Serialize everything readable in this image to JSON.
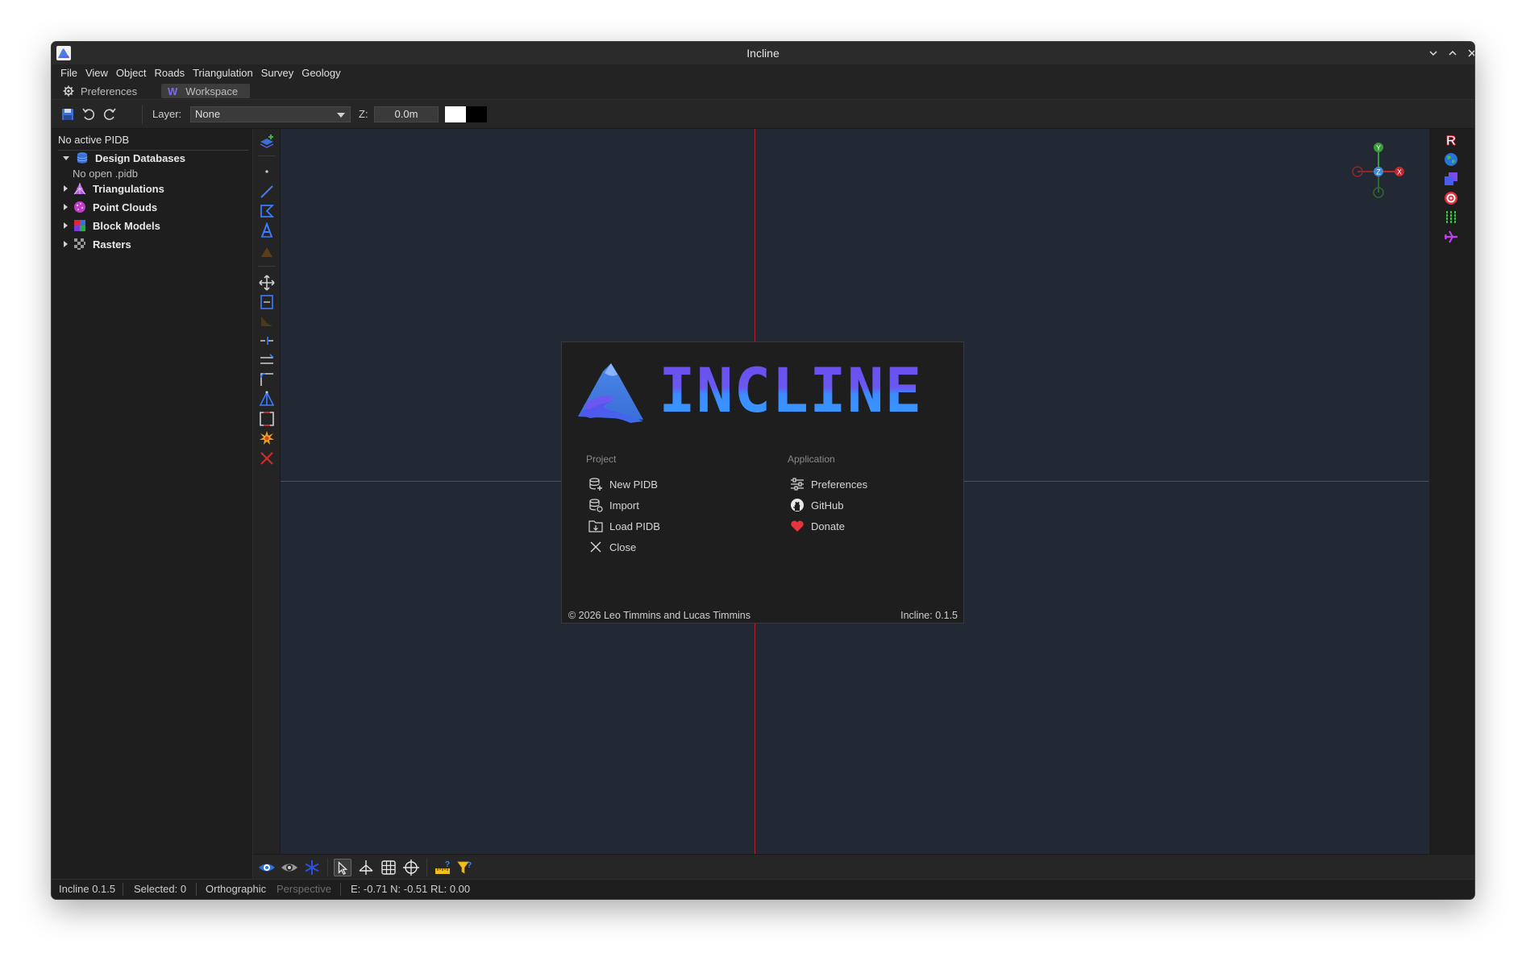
{
  "window": {
    "title": "Incline"
  },
  "menubar": {
    "items": [
      "File",
      "View",
      "Object",
      "Roads",
      "Triangulation",
      "Survey",
      "Geology"
    ]
  },
  "tabs": {
    "preferences": "Preferences",
    "workspace_glyph": "W",
    "workspace": "Workspace"
  },
  "toolbar": {
    "layer_label": "Layer:",
    "layer_value": "None",
    "z_label": "Z:",
    "z_value": "0.0m"
  },
  "left_panel": {
    "status": "No active PIDB",
    "tree": [
      {
        "label": "Design Databases",
        "expanded": true,
        "icon": "database-icon"
      },
      {
        "label": "Triangulations",
        "expanded": false,
        "icon": "triangulation-icon"
      },
      {
        "label": "Point Clouds",
        "expanded": false,
        "icon": "point-cloud-icon"
      },
      {
        "label": "Block Models",
        "expanded": false,
        "icon": "block-model-icon"
      },
      {
        "label": "Rasters",
        "expanded": false,
        "icon": "raster-icon"
      }
    ],
    "design_db_child": "No open .pidb"
  },
  "axis_gizmo": {
    "y": "Y",
    "z": "Z",
    "x": "X"
  },
  "splash": {
    "wordmark": "INCLINE",
    "project_heading": "Project",
    "project_items": [
      "New PIDB",
      "Import",
      "Load PIDB",
      "Close"
    ],
    "application_heading": "Application",
    "application_items": [
      "Preferences",
      "GitHub",
      "Donate"
    ],
    "copyright": "© 2026 Leo Timmins and Lucas Timmins",
    "version": "Incline: 0.1.5"
  },
  "statusbar": {
    "app_version": "Incline 0.1.5",
    "selected": "Selected: 0",
    "view_mode_active": "Orthographic",
    "view_mode_inactive": "Perspective",
    "coords": "E: -0.71 N: -0.51 RL: 0.00"
  },
  "colors": {
    "accent": "#6a58f0",
    "accent_blue": "#3a8cff",
    "crosshair": "#c0242e",
    "viewport_bg": "#222834"
  }
}
